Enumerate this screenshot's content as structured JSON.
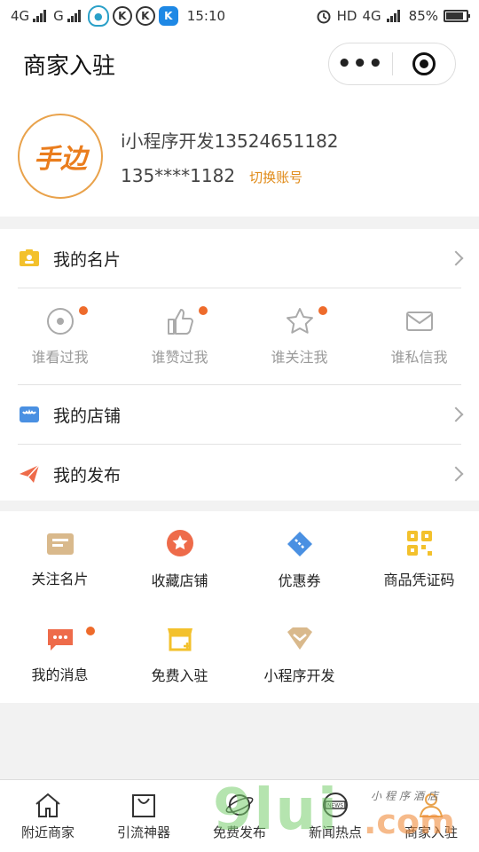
{
  "status_bar": {
    "network1": "4G",
    "network2": "G",
    "time": "15:10",
    "hd": "HD",
    "network3": "4G",
    "battery": "85%"
  },
  "nav": {
    "title": "商家入驻",
    "more_label": "•••"
  },
  "profile": {
    "avatar_text": "手边",
    "name": "i小程序开发13524651182",
    "phone": "135****1182",
    "switch_label": "切换账号"
  },
  "card": {
    "my_card_label": "我的名片",
    "stats": [
      {
        "label": "谁看过我",
        "icon": "eye-icon",
        "badge": true
      },
      {
        "label": "谁赞过我",
        "icon": "thumbs-up-icon",
        "badge": true
      },
      {
        "label": "谁关注我",
        "icon": "star-icon",
        "badge": true
      },
      {
        "label": "谁私信我",
        "icon": "mail-icon",
        "badge": false
      }
    ],
    "my_shop_label": "我的店铺",
    "my_post_label": "我的发布"
  },
  "grid": [
    {
      "label": "关注名片",
      "icon": "card-holder-icon"
    },
    {
      "label": "收藏店铺",
      "icon": "favorite-shop-icon"
    },
    {
      "label": "优惠券",
      "icon": "coupon-icon"
    },
    {
      "label": "商品凭证码",
      "icon": "qr-code-icon"
    },
    {
      "label": "我的消息",
      "icon": "message-icon"
    },
    {
      "label": "免费入驻",
      "icon": "shop-add-icon"
    },
    {
      "label": "小程序开发",
      "icon": "miniprogram-icon"
    }
  ],
  "tabs": [
    {
      "label": "附近商家",
      "icon": "home-icon"
    },
    {
      "label": "引流神器",
      "icon": "shopping-bag-icon"
    },
    {
      "label": "免费发布",
      "icon": "planet-icon"
    },
    {
      "label": "新闻热点",
      "icon": "news-icon"
    },
    {
      "label": "商家入驻",
      "icon": "user-icon"
    }
  ],
  "watermark": {
    "brand": "9lui",
    "domain": ".com",
    "tagline": "小程序酒店"
  },
  "colors": {
    "accent": "#ee6b2b",
    "switch_link": "#e08a17",
    "shop_icon": "#4a90e2",
    "coupon_icon": "#4a90e2",
    "qr_icon": "#f3c12c"
  }
}
